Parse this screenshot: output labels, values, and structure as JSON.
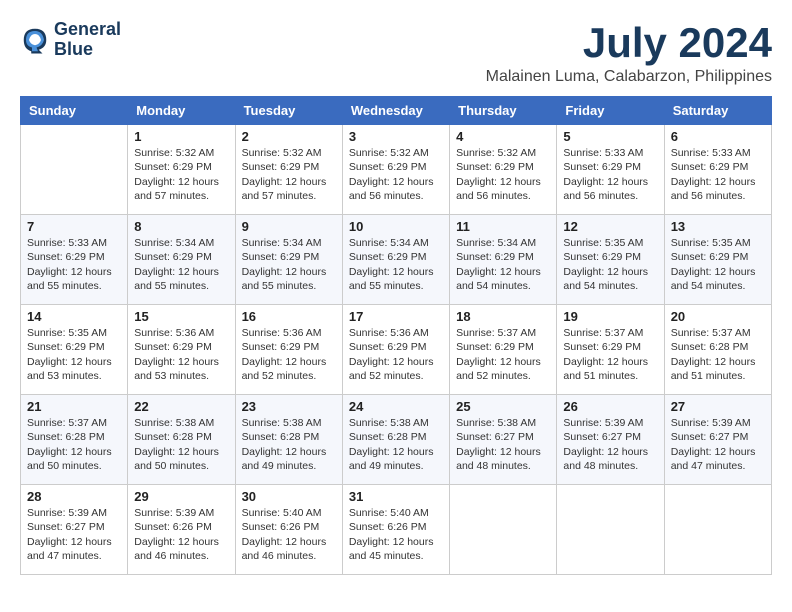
{
  "header": {
    "logo_line1": "General",
    "logo_line2": "Blue",
    "title": "July 2024",
    "subtitle": "Malainen Luma, Calabarzon, Philippines"
  },
  "weekdays": [
    "Sunday",
    "Monday",
    "Tuesday",
    "Wednesday",
    "Thursday",
    "Friday",
    "Saturday"
  ],
  "weeks": [
    [
      {
        "day": "",
        "info": ""
      },
      {
        "day": "1",
        "info": "Sunrise: 5:32 AM\nSunset: 6:29 PM\nDaylight: 12 hours\nand 57 minutes."
      },
      {
        "day": "2",
        "info": "Sunrise: 5:32 AM\nSunset: 6:29 PM\nDaylight: 12 hours\nand 57 minutes."
      },
      {
        "day": "3",
        "info": "Sunrise: 5:32 AM\nSunset: 6:29 PM\nDaylight: 12 hours\nand 56 minutes."
      },
      {
        "day": "4",
        "info": "Sunrise: 5:32 AM\nSunset: 6:29 PM\nDaylight: 12 hours\nand 56 minutes."
      },
      {
        "day": "5",
        "info": "Sunrise: 5:33 AM\nSunset: 6:29 PM\nDaylight: 12 hours\nand 56 minutes."
      },
      {
        "day": "6",
        "info": "Sunrise: 5:33 AM\nSunset: 6:29 PM\nDaylight: 12 hours\nand 56 minutes."
      }
    ],
    [
      {
        "day": "7",
        "info": "Sunrise: 5:33 AM\nSunset: 6:29 PM\nDaylight: 12 hours\nand 55 minutes."
      },
      {
        "day": "8",
        "info": "Sunrise: 5:34 AM\nSunset: 6:29 PM\nDaylight: 12 hours\nand 55 minutes."
      },
      {
        "day": "9",
        "info": "Sunrise: 5:34 AM\nSunset: 6:29 PM\nDaylight: 12 hours\nand 55 minutes."
      },
      {
        "day": "10",
        "info": "Sunrise: 5:34 AM\nSunset: 6:29 PM\nDaylight: 12 hours\nand 55 minutes."
      },
      {
        "day": "11",
        "info": "Sunrise: 5:34 AM\nSunset: 6:29 PM\nDaylight: 12 hours\nand 54 minutes."
      },
      {
        "day": "12",
        "info": "Sunrise: 5:35 AM\nSunset: 6:29 PM\nDaylight: 12 hours\nand 54 minutes."
      },
      {
        "day": "13",
        "info": "Sunrise: 5:35 AM\nSunset: 6:29 PM\nDaylight: 12 hours\nand 54 minutes."
      }
    ],
    [
      {
        "day": "14",
        "info": "Sunrise: 5:35 AM\nSunset: 6:29 PM\nDaylight: 12 hours\nand 53 minutes."
      },
      {
        "day": "15",
        "info": "Sunrise: 5:36 AM\nSunset: 6:29 PM\nDaylight: 12 hours\nand 53 minutes."
      },
      {
        "day": "16",
        "info": "Sunrise: 5:36 AM\nSunset: 6:29 PM\nDaylight: 12 hours\nand 52 minutes."
      },
      {
        "day": "17",
        "info": "Sunrise: 5:36 AM\nSunset: 6:29 PM\nDaylight: 12 hours\nand 52 minutes."
      },
      {
        "day": "18",
        "info": "Sunrise: 5:37 AM\nSunset: 6:29 PM\nDaylight: 12 hours\nand 52 minutes."
      },
      {
        "day": "19",
        "info": "Sunrise: 5:37 AM\nSunset: 6:29 PM\nDaylight: 12 hours\nand 51 minutes."
      },
      {
        "day": "20",
        "info": "Sunrise: 5:37 AM\nSunset: 6:28 PM\nDaylight: 12 hours\nand 51 minutes."
      }
    ],
    [
      {
        "day": "21",
        "info": "Sunrise: 5:37 AM\nSunset: 6:28 PM\nDaylight: 12 hours\nand 50 minutes."
      },
      {
        "day": "22",
        "info": "Sunrise: 5:38 AM\nSunset: 6:28 PM\nDaylight: 12 hours\nand 50 minutes."
      },
      {
        "day": "23",
        "info": "Sunrise: 5:38 AM\nSunset: 6:28 PM\nDaylight: 12 hours\nand 49 minutes."
      },
      {
        "day": "24",
        "info": "Sunrise: 5:38 AM\nSunset: 6:28 PM\nDaylight: 12 hours\nand 49 minutes."
      },
      {
        "day": "25",
        "info": "Sunrise: 5:38 AM\nSunset: 6:27 PM\nDaylight: 12 hours\nand 48 minutes."
      },
      {
        "day": "26",
        "info": "Sunrise: 5:39 AM\nSunset: 6:27 PM\nDaylight: 12 hours\nand 48 minutes."
      },
      {
        "day": "27",
        "info": "Sunrise: 5:39 AM\nSunset: 6:27 PM\nDaylight: 12 hours\nand 47 minutes."
      }
    ],
    [
      {
        "day": "28",
        "info": "Sunrise: 5:39 AM\nSunset: 6:27 PM\nDaylight: 12 hours\nand 47 minutes."
      },
      {
        "day": "29",
        "info": "Sunrise: 5:39 AM\nSunset: 6:26 PM\nDaylight: 12 hours\nand 46 minutes."
      },
      {
        "day": "30",
        "info": "Sunrise: 5:40 AM\nSunset: 6:26 PM\nDaylight: 12 hours\nand 46 minutes."
      },
      {
        "day": "31",
        "info": "Sunrise: 5:40 AM\nSunset: 6:26 PM\nDaylight: 12 hours\nand 45 minutes."
      },
      {
        "day": "",
        "info": ""
      },
      {
        "day": "",
        "info": ""
      },
      {
        "day": "",
        "info": ""
      }
    ]
  ]
}
